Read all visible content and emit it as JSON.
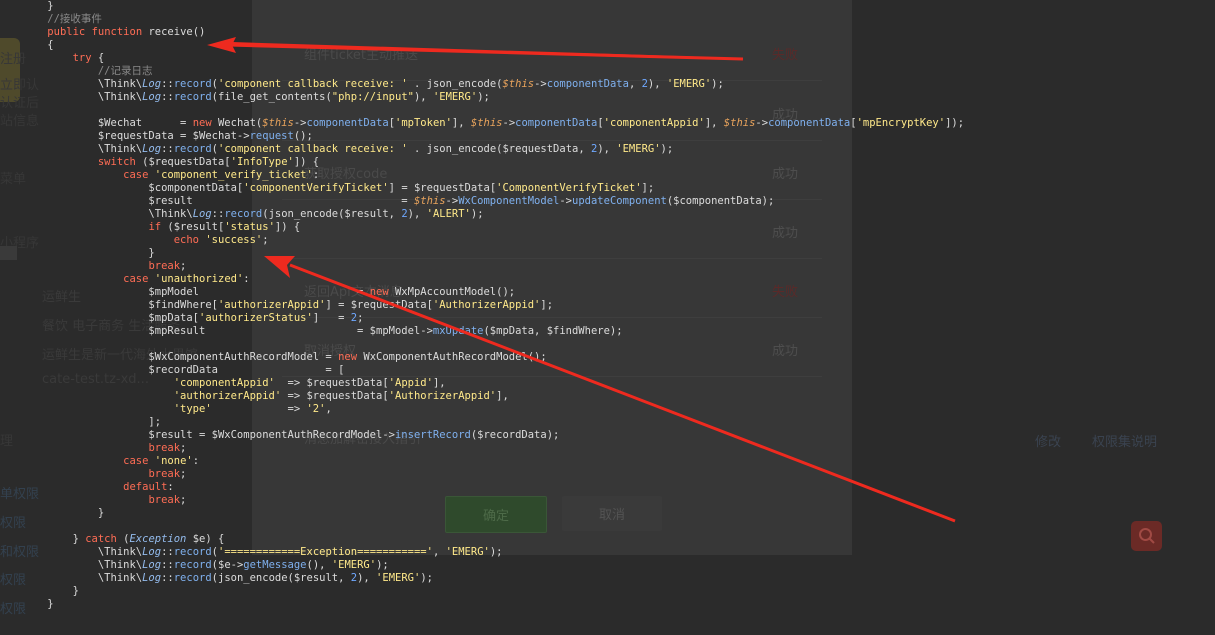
{
  "background_page": {
    "side_texts": [
      "注册",
      "立即认",
      "认证后",
      "站信息",
      "菜单",
      "小程序",
      "理",
      "单权限",
      "权限",
      "和权限",
      "权限",
      "权限"
    ],
    "middle_texts": [
      "运鲜生",
      "餐饮 电子商务 生活服务",
      "运鲜生是新一代海外水果馆",
      "cate-test.tz-xd..."
    ],
    "links": [
      "修改",
      "权限集说明"
    ],
    "search_icon": "search-icon"
  },
  "modal": {
    "rows": [
      {
        "label": "组件ticket主动推送",
        "status": "失败",
        "kind": "fail"
      },
      {
        "label": "",
        "status": "成功",
        "kind": "ok"
      },
      {
        "label": "获取授权code",
        "status": "成功",
        "kind": "ok"
      },
      {
        "label": "",
        "status": "成功",
        "kind": "ok"
      },
      {
        "label": "返回Api文本消息",
        "status": "失败",
        "kind": "fail"
      },
      {
        "label": "取消授权",
        "status": "成功",
        "kind": "ok"
      }
    ],
    "footer_text": "消息加解密接入指引",
    "ok_label": "确定",
    "cancel_label": "取消"
  },
  "code": {
    "lines": [
      "    }",
      "    //接收事件",
      "    public function receive()",
      "    {",
      "        try {",
      "            //记录日志",
      "            \\Think\\Log::record('component callback receive: ' . json_encode($this->componentData, 2), 'EMERG');",
      "            \\Think\\Log::record(file_get_contents(\"php://input\"), 'EMERG');",
      "",
      "            $Wechat      = new Wechat($this->componentData['mpToken'], $this->componentData['componentAppid'], $this->componentData['mpEncryptKey']);",
      "            $requestData = $Wechat->request();",
      "            \\Think\\Log::record('component callback receive: ' . json_encode($requestData, 2), 'EMERG');",
      "            switch ($requestData['InfoType']) {",
      "                case 'component_verify_ticket':",
      "                    $componentData['componentVerifyTicket'] = $requestData['ComponentVerifyTicket'];",
      "                    $result                                 = $this->WxComponentModel->updateComponent($componentData);",
      "                    \\Think\\Log::record(json_encode($result, 2), 'ALERT');",
      "                    if ($result['status']) {",
      "                        echo 'success';",
      "                    }",
      "                    break;",
      "                case 'unauthorized':",
      "                    $mpModel                         = new WxMpAccountModel();",
      "                    $findWhere['authorizerAppid'] = $requestData['AuthorizerAppid'];",
      "                    $mpData['authorizerStatus']   = 2;",
      "                    $mpResult                        = $mpModel->mxUpdate($mpData, $findWhere);",
      "",
      "                    $WxComponentAuthRecordModel = new WxComponentAuthRecordModel();",
      "                    $recordData                 = [",
      "                        'componentAppid'  => $requestData['Appid'],",
      "                        'authorizerAppid' => $requestData['AuthorizerAppid'],",
      "                        'type'            => '2',",
      "                    ];",
      "                    $result = $WxComponentAuthRecordModel->insertRecord($recordData);",
      "                    break;",
      "                case 'none':",
      "                    break;",
      "                default:",
      "                    break;",
      "            }",
      "",
      "        } catch (Exception $e) {",
      "            \\Think\\Log::record('============Exception===========', 'EMERG');",
      "            \\Think\\Log::record($e->getMessage(), 'EMERG');",
      "            \\Think\\Log::record(json_encode($result, 2), 'EMERG');",
      "        }",
      "    }"
    ]
  },
  "annotation_color": "#ee2a1f"
}
